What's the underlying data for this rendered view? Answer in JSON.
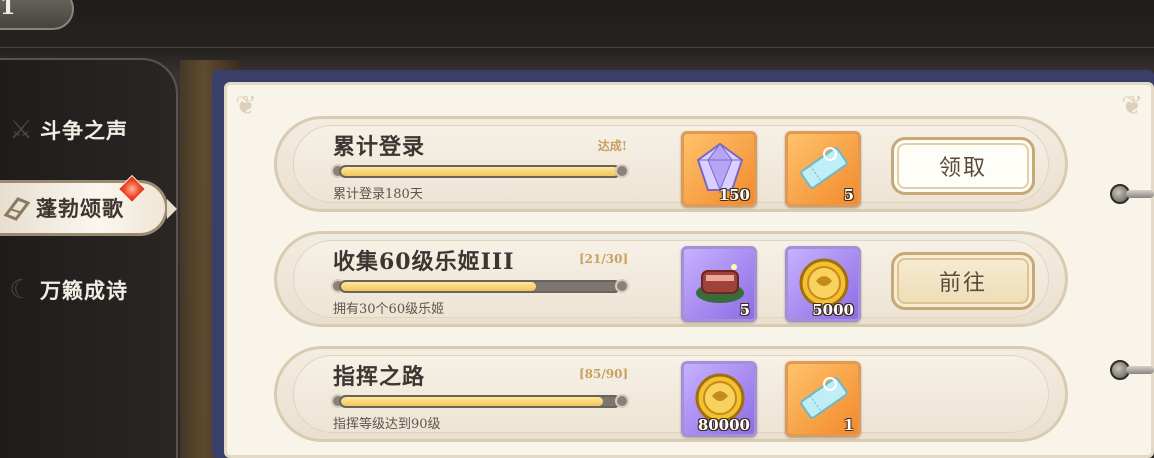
{
  "header": {
    "label": "1"
  },
  "sidebar": {
    "items": [
      {
        "label": "斗争之声",
        "icon": "crossed-swords-icon",
        "active": false
      },
      {
        "label": "蓬勃颂歌",
        "icon": "horn-icon",
        "active": true,
        "has_notification": true
      },
      {
        "label": "万籁成诗",
        "icon": "moon-icon",
        "active": false
      }
    ]
  },
  "tasks": [
    {
      "title": "累计登录",
      "status": "达成!",
      "description": "累计登录180天",
      "progress": 1.0,
      "rewards": [
        {
          "icon": "crystal-gem-icon",
          "count": "150",
          "rarity": "orange"
        },
        {
          "icon": "ticket-icon",
          "count": "5",
          "rarity": "orange"
        }
      ],
      "action": "领取"
    },
    {
      "title": "收集60级乐姬III",
      "status": "[21/30]",
      "description": "拥有30个60级乐姬",
      "progress": 0.7,
      "rewards": [
        {
          "icon": "meat-icon",
          "count": "5",
          "rarity": "purple"
        },
        {
          "icon": "gold-coin-icon",
          "count": "5000",
          "rarity": "purple"
        }
      ],
      "action": "前往"
    },
    {
      "title": "指挥之路",
      "status": "[85/90]",
      "description": "指挥等级达到90级",
      "progress": 0.944,
      "rewards": [
        {
          "icon": "gold-coin-icon",
          "count": "80000",
          "rarity": "purple"
        },
        {
          "icon": "ticket-icon",
          "count": "1",
          "rarity": "orange"
        }
      ],
      "action": ""
    }
  ],
  "colors": {
    "accent_gold": "#c8a060",
    "bar_fill": "#f2c55a",
    "panel_bg": "#f8f4ea",
    "book_back": "#3a3f6a"
  }
}
